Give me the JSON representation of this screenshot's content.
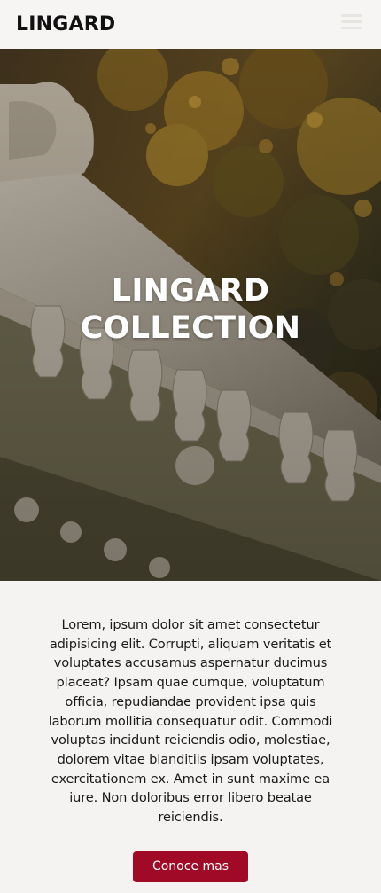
{
  "header": {
    "brand": "LINGARD",
    "menu_icon": "hamburger-menu-icon"
  },
  "hero": {
    "title_line1": "LINGARD",
    "title_line2": "COLLECTION",
    "image_subject": "white stone balustrade under autumn tree foliage"
  },
  "content": {
    "paragraph": "Lorem, ipsum dolor sit amet consectetur adipisicing elit. Corrupti, aliquam veritatis et voluptates accusamus aspernatur ducimus placeat? Ipsam quae cumque, voluptatum officia, repudiandae provident ipsa quis laborum mollitia consequatur odit. Commodi voluptas incidunt reiciendis odio, molestiae, dolorem vitae blanditiis ipsam voluptates, exercitationem ex. Amet in sunt maxime ea iure. Non doloribus error libero beatae reiciendis.",
    "cta_label": "Conoce mas"
  },
  "colors": {
    "accent": "#a10a26",
    "page_background": "#f5f3f1",
    "header_background": "#f6f5f3",
    "text": "#1a1a1a"
  }
}
